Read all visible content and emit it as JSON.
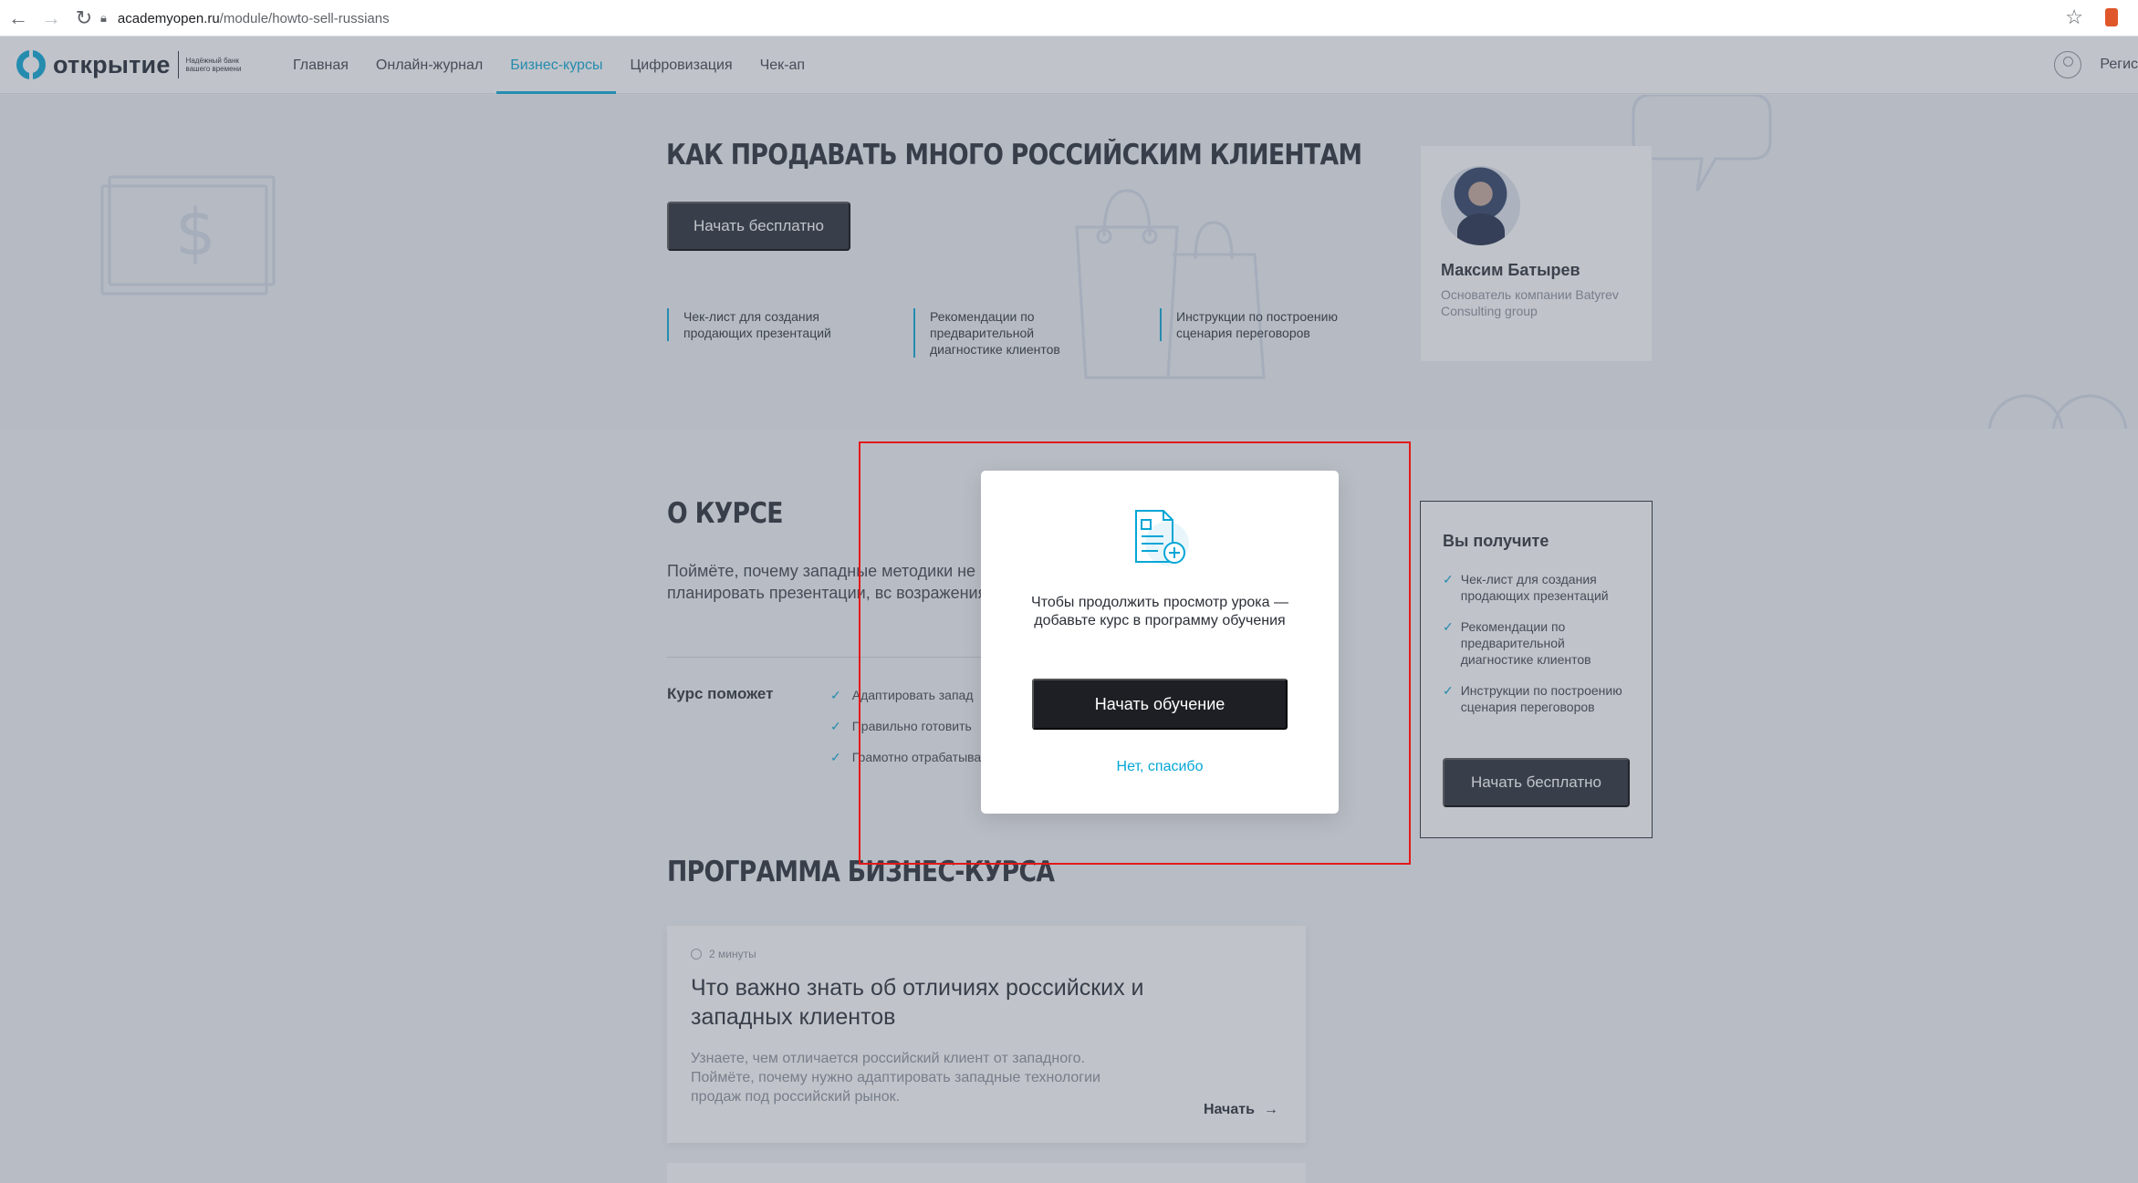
{
  "browser": {
    "url_host": "academyopen.ru",
    "url_path": "/module/howto-sell-russians"
  },
  "header": {
    "logo_text": "открытие",
    "logo_slogan": "Надёжный банк вашего времени",
    "menu": [
      {
        "label": "Главная"
      },
      {
        "label": "Онлайн-журнал"
      },
      {
        "label": "Бизнес-курсы",
        "active": true
      },
      {
        "label": "Цифровизация"
      },
      {
        "label": "Чек-ап"
      }
    ],
    "user_label": "Регис"
  },
  "hero": {
    "title": "КАК ПРОДАВАТЬ МНОГО РОССИЙСКИМ КЛИЕНТАМ",
    "start_button": "Начать бесплатно",
    "features": [
      "Чек-лист для создания продающих презентаций",
      "Рекомендации по предварительной диагностике клиентов",
      "Инструкции по построению сценария переговоров"
    ],
    "author": {
      "name": "Максим Батырев",
      "role": "Основатель компании Batyrev Consulting group"
    }
  },
  "about": {
    "title": "О КУРСЕ",
    "text": "Поймёте, почему западные методики не Научитесь планировать презентации, вс возражения.",
    "helps_label": "Курс поможет",
    "helps_items": [
      "Адаптировать запад",
      "Правильно готовить",
      "Грамотно отрабатыва"
    ]
  },
  "benefits": {
    "title": "Вы получите",
    "items": [
      "Чек-лист для создания продающих презентаций",
      "Рекомендации по предварительной диагностике клиентов",
      "Инструкции по построению сценария переговоров"
    ],
    "button": "Начать бесплатно"
  },
  "program": {
    "title": "ПРОГРАММА БИЗНЕС-КУРСА",
    "lessons": [
      {
        "duration": "2 минуты",
        "title": "Что важно знать об отличиях российских и западных клиентов",
        "description": "Узнаете, чем отличается российский клиент от западного. Поймёте, почему нужно адаптировать западные технологии продаж под российский рынок.",
        "start_label": "Начать"
      }
    ]
  },
  "modal": {
    "icon": "document-add-icon",
    "text": "Чтобы продолжить просмотр урока — добавьте курс в программу обучения",
    "primary_button": "Начать обучение",
    "secondary_link": "Нет, спасибо"
  },
  "colors": {
    "accent": "#05a6d6",
    "dark_button": "#262b33",
    "highlight_border": "#e21a1a"
  }
}
